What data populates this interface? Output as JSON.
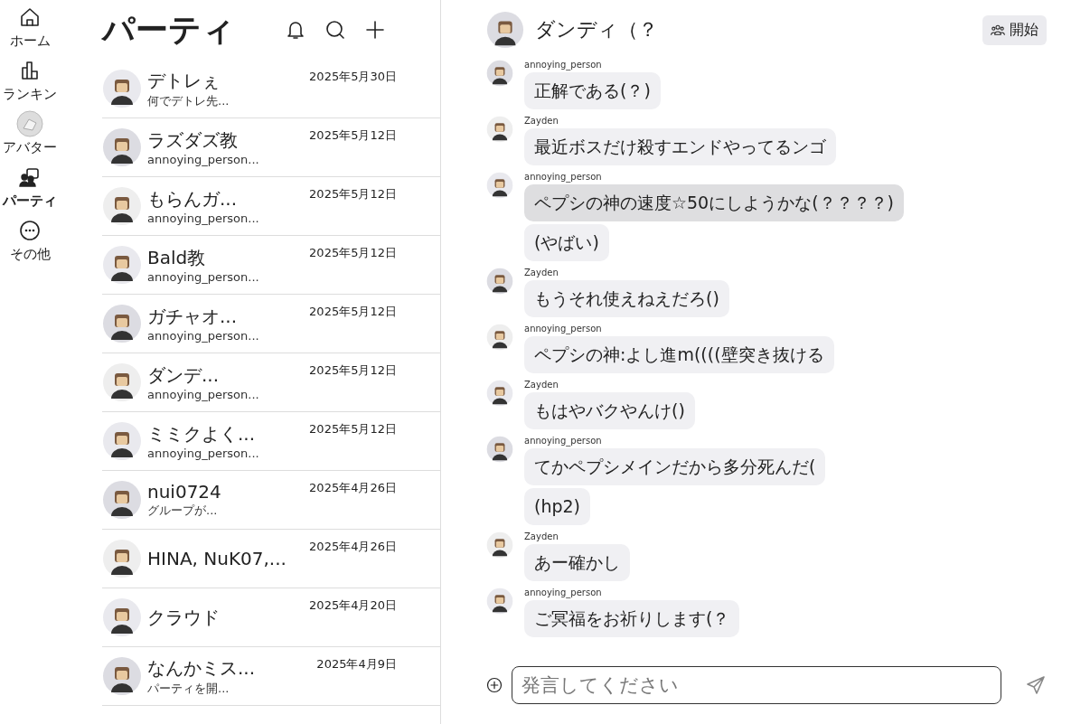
{
  "nav": [
    {
      "label": "ホーム",
      "selected": false
    },
    {
      "label": "ランキン",
      "selected": false
    },
    {
      "label": "アバター",
      "selected": false
    },
    {
      "label": "パーティ",
      "selected": true
    },
    {
      "label": "その他",
      "selected": false
    }
  ],
  "list": {
    "title": "パーティ",
    "rows": [
      {
        "name": "デトレぇ",
        "date": "2025年5月30日",
        "preview": "何でデトレ先..."
      },
      {
        "name": "ラズダズ教",
        "date": "2025年5月12日",
        "preview": "annoying_person..."
      },
      {
        "name": "もらんガ...",
        "date": "2025年5月12日",
        "preview": "annoying_person..."
      },
      {
        "name": "Bald教",
        "date": "2025年5月12日",
        "preview": "annoying_person..."
      },
      {
        "name": "ガチャオ...",
        "date": "2025年5月12日",
        "preview": "annoying_person..."
      },
      {
        "name": "ダンデ...",
        "date": "2025年5月12日",
        "preview": "annoying_person..."
      },
      {
        "name": "ミミクよく...",
        "date": "2025年5月12日",
        "preview": "annoying_person..."
      },
      {
        "name": "nui0724",
        "date": "2025年4月26日",
        "preview": "グループが..."
      },
      {
        "name": "HINA, NuK07,...",
        "date": "2025年4月26日"
      },
      {
        "name": "クラウド",
        "date": "2025年4月20日"
      },
      {
        "name": "なんかミス...",
        "date": "2025年4月9日",
        "preview": "パーティを開..."
      }
    ]
  },
  "chat": {
    "title": "ダンディ（？",
    "start_button": "開始",
    "groups": [
      {
        "sender": "annoying_person",
        "messages": [
          {
            "text": "正解である(？)",
            "highlighted": false
          }
        ]
      },
      {
        "sender": "Zayden",
        "messages": [
          {
            "text": "最近ボスだけ殺すエンドやってるンゴ",
            "highlighted": false
          }
        ]
      },
      {
        "sender": "annoying_person",
        "messages": [
          {
            "text": "ペプシの神の速度☆50にしようかな(？？？？)",
            "highlighted": true
          },
          {
            "text": "(やばい)",
            "highlighted": false
          }
        ]
      },
      {
        "sender": "Zayden",
        "messages": [
          {
            "text": "もうそれ使えねえだろ()",
            "highlighted": false
          }
        ]
      },
      {
        "sender": "annoying_person",
        "messages": [
          {
            "text": "ペプシの神:よし進m((((壁突き抜ける",
            "highlighted": false
          }
        ]
      },
      {
        "sender": "Zayden",
        "messages": [
          {
            "text": "もはやバクやんけ()",
            "highlighted": false
          }
        ]
      },
      {
        "sender": "annoying_person",
        "messages": [
          {
            "text": "てかペプシメインだから多分死んだ(",
            "highlighted": false
          },
          {
            "text": "(hp2)",
            "highlighted": false
          }
        ]
      },
      {
        "sender": "Zayden",
        "messages": [
          {
            "text": "あー確かし",
            "highlighted": false
          }
        ]
      },
      {
        "sender": "annoying_person",
        "messages": [
          {
            "text": "ご冥福をお祈りします(？",
            "highlighted": false
          }
        ]
      }
    ],
    "input": {
      "placeholder": "発言してください"
    }
  }
}
